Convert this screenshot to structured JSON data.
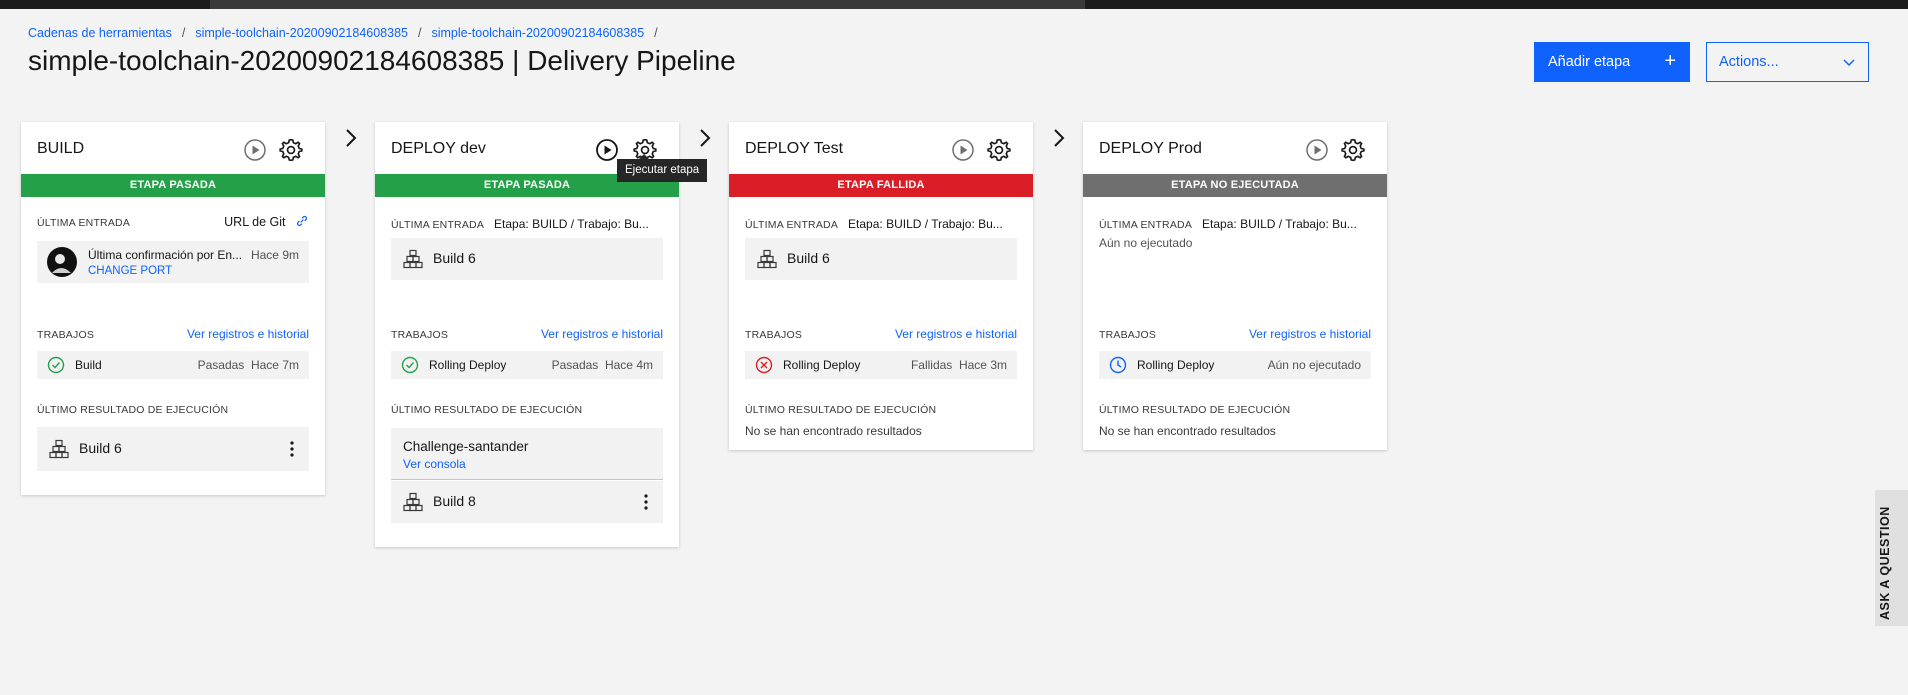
{
  "breadcrumb": {
    "item1": "Cadenas de herramientas",
    "item2": "simple-toolchain-20200902184608385",
    "item3": "simple-toolchain-20200902184608385",
    "sep": "/"
  },
  "page_title": "simple-toolchain-20200902184608385 | Delivery Pipeline",
  "toolbar": {
    "add_stage_label": "Añadir etapa",
    "add_icon": "+",
    "actions_label": "Actions..."
  },
  "colors": {
    "passed": "#24a148",
    "failed": "#da1e28",
    "not_run": "#6f6f6f",
    "accent": "#0f62fe"
  },
  "tooltip": "Ejecutar etapa",
  "ask_question": "ASK A QUESTION",
  "labels": {
    "last_input": "ÚLTIMA ENTRADA",
    "jobs": "TRABAJOS",
    "last_result": "ÚLTIMO RESULTADO DE EJECUCIÓN",
    "logs_link": "Ver registros e historial",
    "input_stage_meta": "Etapa: BUILD  /  Trabajo: Bu..."
  },
  "stages": [
    {
      "title": "BUILD",
      "status": "ETAPA PASADA",
      "input_link": "URL de Git",
      "commit_text": "Última confirmación por En...",
      "commit_time": "Hace 9m",
      "commit_link": "CHANGE PORT",
      "job": {
        "name": "Build",
        "result": "Pasadas",
        "time": "Hace 7m",
        "icon": "check-circle-icon"
      },
      "result_build": "Build 6"
    },
    {
      "title": "DEPLOY dev",
      "status": "ETAPA PASADA",
      "input_build": "Build 6",
      "job": {
        "name": "Rolling Deploy",
        "result": "Pasadas",
        "time": "Hace 4m",
        "icon": "check-circle-icon"
      },
      "result_app": "Challenge-santander",
      "result_console": "Ver consola",
      "result_build": "Build 8"
    },
    {
      "title": "DEPLOY Test",
      "status": "ETAPA FALLIDA",
      "input_build": "Build 6",
      "job": {
        "name": "Rolling Deploy",
        "result": "Fallidas",
        "time": "Hace 3m",
        "icon": "error-circle-icon"
      },
      "no_results": "No se han encontrado resultados"
    },
    {
      "title": "DEPLOY Prod",
      "status": "ETAPA NO EJECUTADA",
      "input_none": "Aún no ejecutado",
      "job": {
        "name": "Rolling Deploy",
        "result": "Aún no ejecutado",
        "icon": "clock-icon"
      },
      "no_results": "No se han encontrado resultados"
    }
  ]
}
